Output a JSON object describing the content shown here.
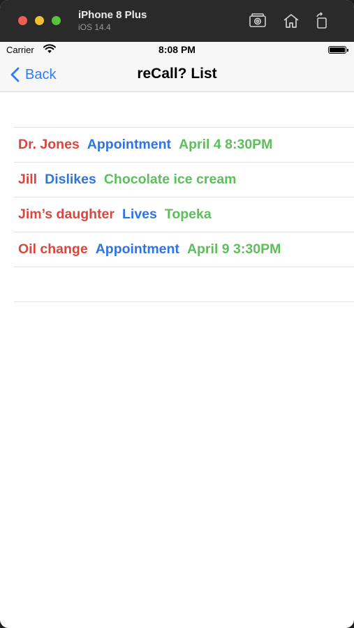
{
  "simulator": {
    "device_name": "iPhone 8 Plus",
    "os_version": "iOS 14.4",
    "icons": [
      "screenshot-icon",
      "home-icon",
      "rotate-icon"
    ]
  },
  "status_bar": {
    "carrier": "Carrier",
    "time": "8:08 PM"
  },
  "nav": {
    "back_label": "Back",
    "title": "reCall? List"
  },
  "colors": {
    "who": "#d9463e",
    "what": "#2f74e0",
    "detail": "#5cbf5a",
    "accent": "#2f7cf6"
  },
  "list": {
    "items": [
      {
        "who": "Dr. Jones",
        "what": "Appointment",
        "detail": "April 4 8:30PM"
      },
      {
        "who": "Jill",
        "what": "Dislikes",
        "detail": "Chocolate ice cream"
      },
      {
        "who": "Jim’s daughter",
        "what": "Lives",
        "detail": "Topeka"
      },
      {
        "who": "Oil change",
        "what": "Appointment",
        "detail": "April 9 3:30PM"
      }
    ]
  }
}
